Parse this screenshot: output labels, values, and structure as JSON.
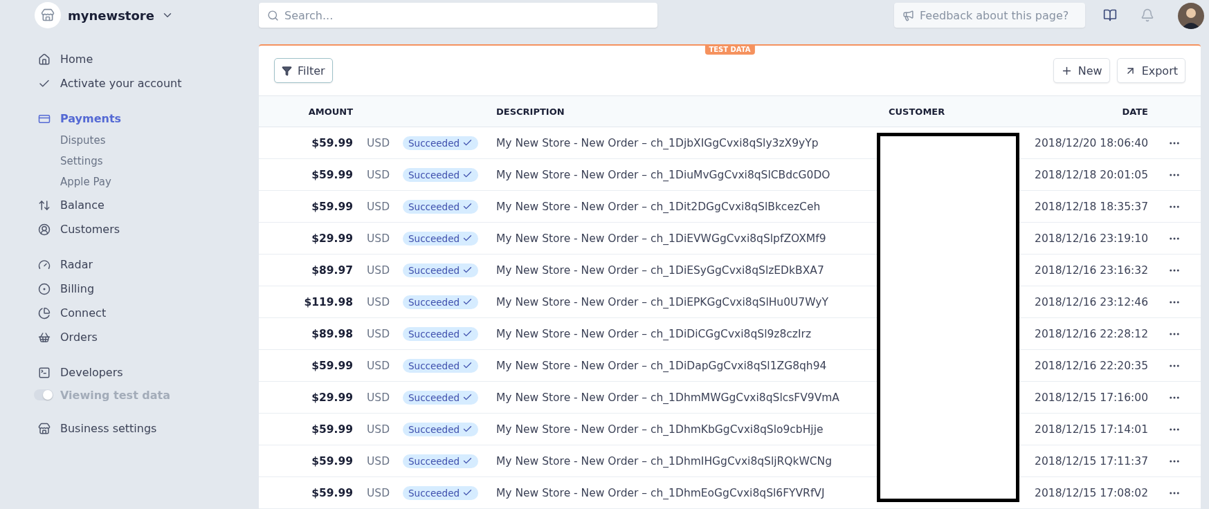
{
  "brand": {
    "name": "mynewstore"
  },
  "search": {
    "placeholder": "Search..."
  },
  "feedback": {
    "placeholder": "Feedback about this page?"
  },
  "sidebar": {
    "groups": [
      {
        "items": [
          {
            "label": "Home",
            "kind": "link",
            "selected": false
          },
          {
            "label": "Activate your account",
            "kind": "link",
            "selected": false
          }
        ]
      },
      {
        "items": [
          {
            "label": "Payments",
            "kind": "link",
            "selected": true,
            "children": [
              {
                "label": "Disputes",
                "selected": false
              },
              {
                "label": "Settings",
                "selected": false
              },
              {
                "label": "Apple Pay",
                "selected": false
              }
            ]
          },
          {
            "label": "Balance",
            "kind": "link",
            "selected": false
          },
          {
            "label": "Customers",
            "kind": "link",
            "selected": false
          }
        ]
      },
      {
        "items": [
          {
            "label": "Radar",
            "kind": "link",
            "selected": false
          },
          {
            "label": "Billing",
            "kind": "link",
            "selected": false
          },
          {
            "label": "Connect",
            "kind": "link",
            "selected": false
          },
          {
            "label": "Orders",
            "kind": "link",
            "selected": false
          }
        ]
      },
      {
        "items": [
          {
            "label": "Developers",
            "kind": "link",
            "selected": false
          },
          {
            "label": "Viewing test data",
            "kind": "toggle",
            "on": true
          }
        ]
      },
      {
        "items": [
          {
            "label": "Business settings",
            "kind": "link",
            "selected": false
          }
        ]
      }
    ]
  },
  "badge": "TEST DATA",
  "toolbar": {
    "filter": "Filter",
    "new": "New",
    "export": "Export"
  },
  "table": {
    "columns": [
      "AMOUNT",
      "DESCRIPTION",
      "CUSTOMER",
      "DATE"
    ],
    "rows": [
      {
        "amount": "$59.99",
        "currency": "USD",
        "status": "Succeeded",
        "description": "My New Store - New Order – ch_1DjbXIGgCvxi8qSly3zX9yYp",
        "date": "2018/12/20 18:06:40"
      },
      {
        "amount": "$59.99",
        "currency": "USD",
        "status": "Succeeded",
        "description": "My New Store - New Order – ch_1DiuMvGgCvxi8qSlCBdcG0DO",
        "date": "2018/12/18 20:01:05"
      },
      {
        "amount": "$59.99",
        "currency": "USD",
        "status": "Succeeded",
        "description": "My New Store - New Order – ch_1Dit2DGgCvxi8qSlBkcezCeh",
        "date": "2018/12/18 18:35:37"
      },
      {
        "amount": "$29.99",
        "currency": "USD",
        "status": "Succeeded",
        "description": "My New Store - New Order – ch_1DiEVWGgCvxi8qSlpfZOXMf9",
        "date": "2018/12/16 23:19:10"
      },
      {
        "amount": "$89.97",
        "currency": "USD",
        "status": "Succeeded",
        "description": "My New Store - New Order – ch_1DiESyGgCvxi8qSlzEDkBXA7",
        "date": "2018/12/16 23:16:32"
      },
      {
        "amount": "$119.98",
        "currency": "USD",
        "status": "Succeeded",
        "description": "My New Store - New Order – ch_1DiEPKGgCvxi8qSlHu0U7WyY",
        "date": "2018/12/16 23:12:46"
      },
      {
        "amount": "$89.98",
        "currency": "USD",
        "status": "Succeeded",
        "description": "My New Store - New Order – ch_1DiDiCGgCvxi8qSl9z8czIrz",
        "date": "2018/12/16 22:28:12"
      },
      {
        "amount": "$59.99",
        "currency": "USD",
        "status": "Succeeded",
        "description": "My New Store - New Order – ch_1DiDapGgCvxi8qSl1ZG8qh94",
        "date": "2018/12/16 22:20:35"
      },
      {
        "amount": "$29.99",
        "currency": "USD",
        "status": "Succeeded",
        "description": "My New Store - New Order – ch_1DhmMWGgCvxi8qSlcsFV9VmA",
        "date": "2018/12/15 17:16:00"
      },
      {
        "amount": "$59.99",
        "currency": "USD",
        "status": "Succeeded",
        "description": "My New Store - New Order – ch_1DhmKbGgCvxi8qSlo9cbHjje",
        "date": "2018/12/15 17:14:01"
      },
      {
        "amount": "$59.99",
        "currency": "USD",
        "status": "Succeeded",
        "description": "My New Store - New Order – ch_1DhmIHGgCvxi8qSljRQkWCNg",
        "date": "2018/12/15 17:11:37"
      },
      {
        "amount": "$59.99",
        "currency": "USD",
        "status": "Succeeded",
        "description": "My New Store - New Order – ch_1DhmEoGgCvxi8qSl6FYVRfVJ",
        "date": "2018/12/15 17:08:02"
      }
    ]
  }
}
